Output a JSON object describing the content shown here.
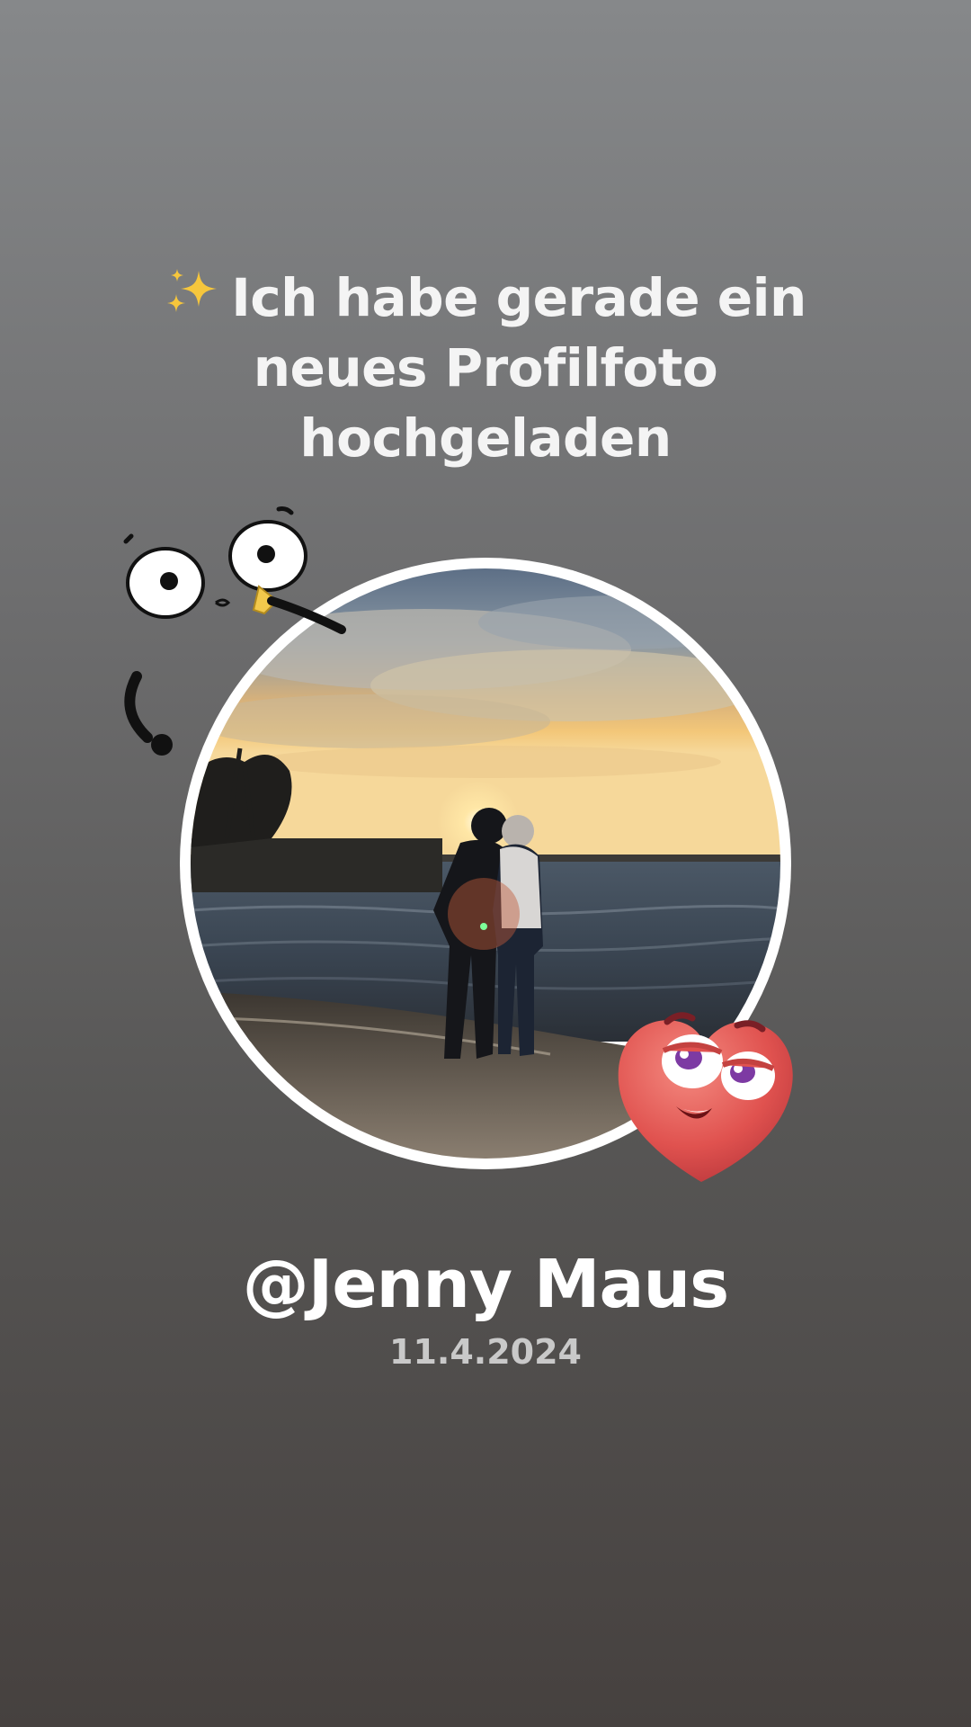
{
  "headline": {
    "emoji": "sparkles-emoji",
    "line1": "Ich habe gerade ein",
    "line2": "neues Profilfoto",
    "line3": "hochgeladen"
  },
  "profile": {
    "username": "@Jenny Maus",
    "date": "11.4.2024"
  },
  "photo": {
    "description_icon": "couple-sunset-photo"
  },
  "stickers": {
    "doodle": "googly-eyes-doodle-sticker",
    "heart": "smirking-heart-sticker"
  },
  "colors": {
    "text": "#f4f4f4",
    "date": "#c9c9c9",
    "ring": "#ffffff",
    "heart": "#e0524f"
  }
}
